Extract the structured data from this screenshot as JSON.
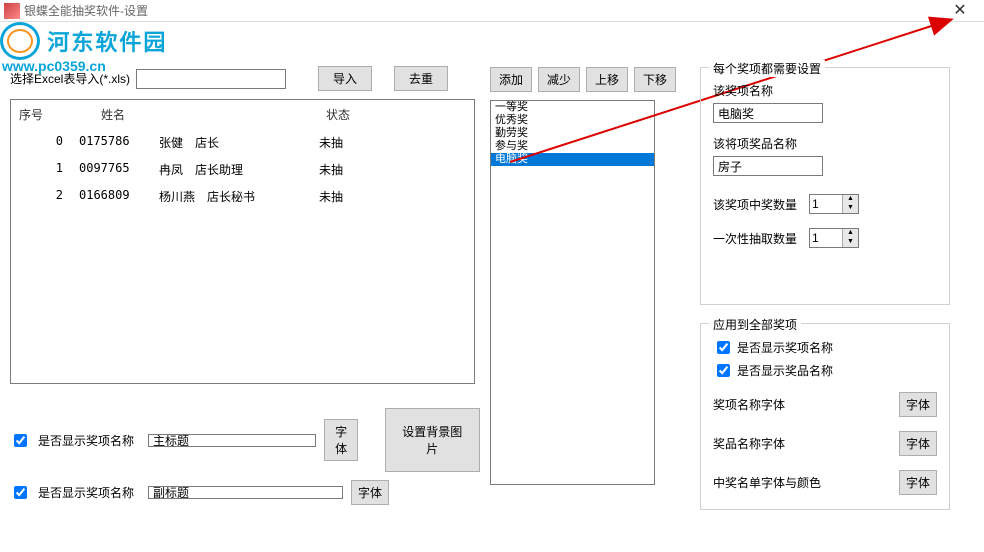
{
  "titlebar": {
    "text": "银蝶全能抽奖软件-设置"
  },
  "watermark": {
    "name": "河东软件园",
    "url": "www.pc0359.cn"
  },
  "importRow": {
    "label": "选择Excel表导入(*.xls)",
    "value": "",
    "importBtn": "导入",
    "dedupBtn": "去重"
  },
  "listButtons": {
    "add": "添加",
    "remove": "减少",
    "up": "上移",
    "down": "下移"
  },
  "table": {
    "headers": {
      "seq": "序号",
      "name": "姓名",
      "status": "状态"
    },
    "rows": [
      {
        "seq": "0",
        "code": "0175786",
        "name": "张健　店长",
        "status": "未抽"
      },
      {
        "seq": "1",
        "code": "0097765",
        "name": "冉凤　店长助理",
        "status": "未抽"
      },
      {
        "seq": "2",
        "code": "0166809",
        "name": "杨川燕　店长秘书",
        "status": "未抽"
      }
    ]
  },
  "prizeList": {
    "items": [
      "一等奖",
      "优秀奖",
      "勤劳奖",
      "参与奖",
      "电脑奖"
    ],
    "selectedIndex": 4
  },
  "bottomLeft": {
    "chk1": "是否显示奖项名称",
    "chk2": "是否显示奖项名称",
    "title1": "主标题",
    "title2": "副标题",
    "fontBtn": "字体",
    "bgBtn": "设置背景图片"
  },
  "rightTop": {
    "groupLabel": "每个奖项都需要设置",
    "prizeNameLabel": "该奖项名称",
    "prizeNameValue": "电脑奖",
    "itemNameLabel": "该将项奖品名称",
    "itemNameValue": "房子",
    "winnersLabel": "该奖项中奖数量",
    "winnersValue": "1",
    "perDrawLabel": "一次性抽取数量",
    "perDrawValue": "1"
  },
  "rightBottom": {
    "groupLabel": "应用到全部奖项",
    "chkShowPrize": "是否显示奖项名称",
    "chkShowItem": "是否显示奖品名称",
    "prizeFontLabel": "奖项名称字体",
    "itemFontLabel": "奖品名称字体",
    "winnerFontLabel": "中奖名单字体与颜色",
    "fontBtn": "字体"
  }
}
